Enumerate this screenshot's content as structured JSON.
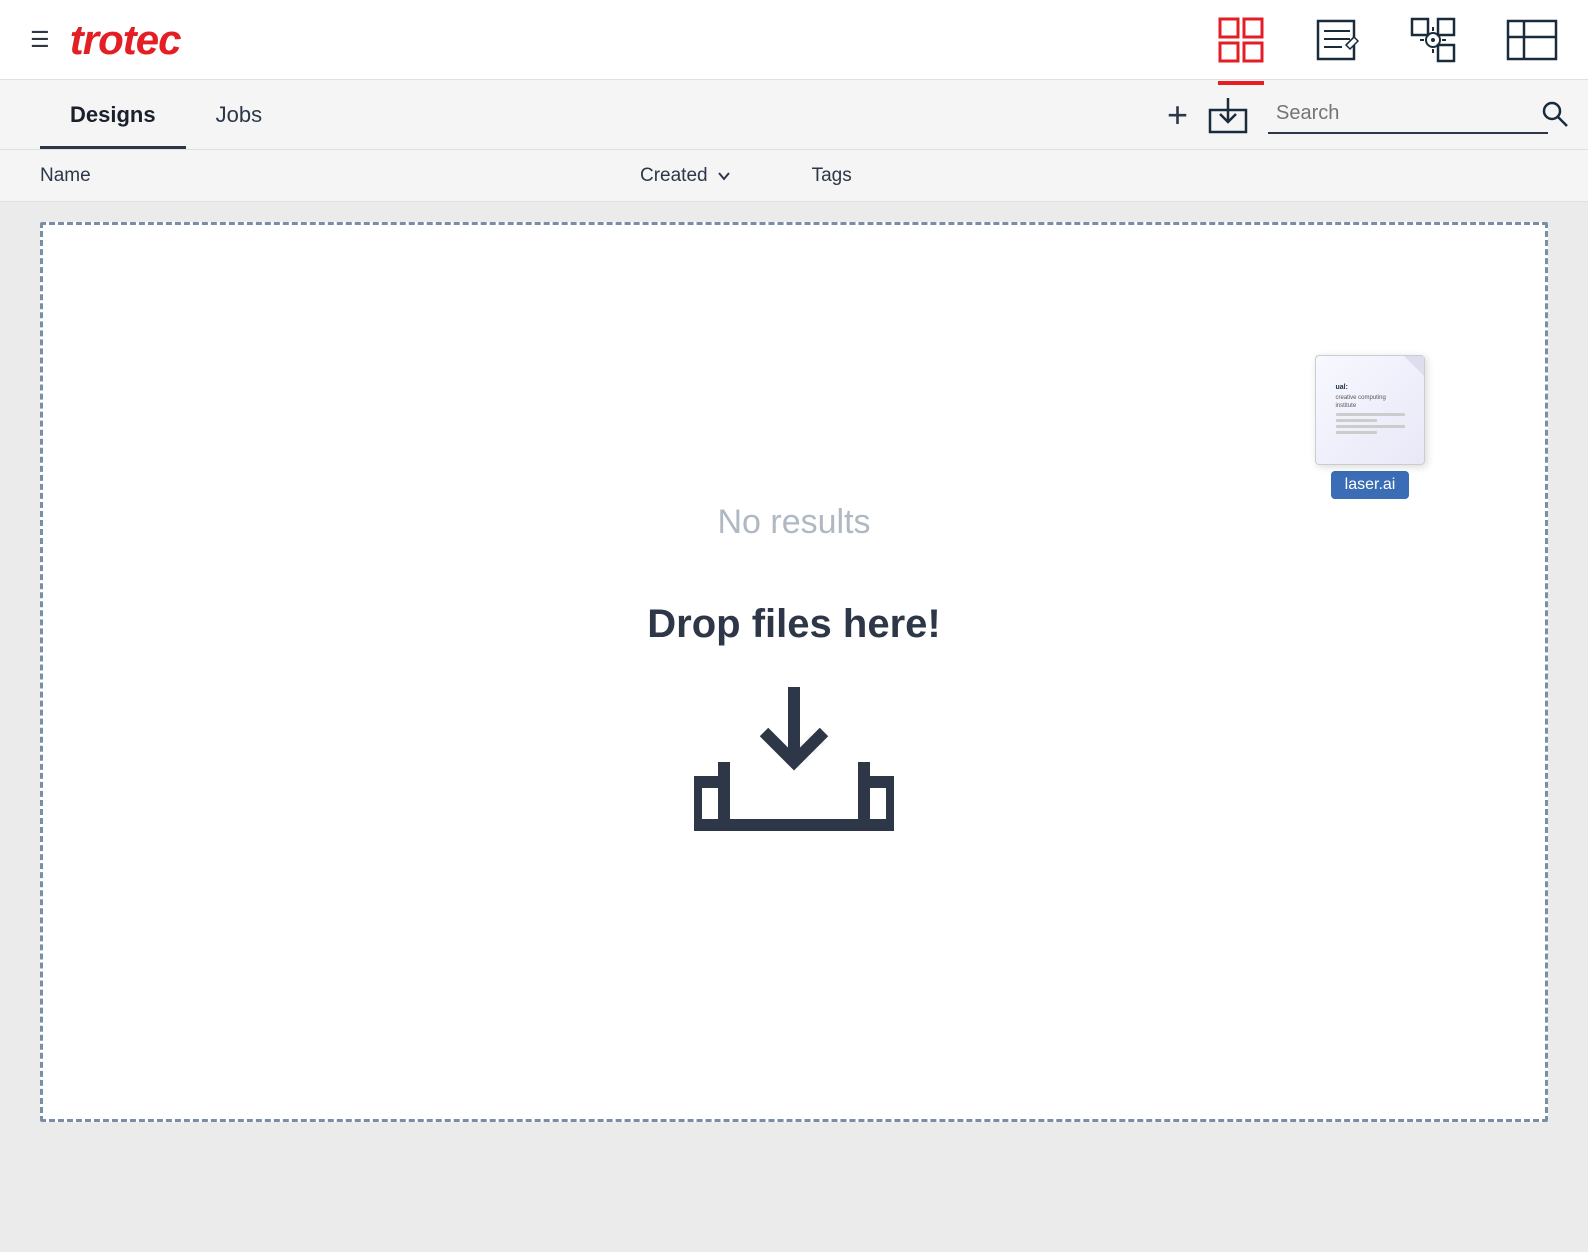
{
  "header": {
    "menu_label": "☰",
    "logo": "trotec",
    "icons": {
      "grid": "grid-icon",
      "edit": "edit-icon",
      "target": "target-icon",
      "panel": "panel-icon"
    }
  },
  "tabs": {
    "designs_label": "Designs",
    "jobs_label": "Jobs"
  },
  "toolbar": {
    "add_label": "+",
    "search_placeholder": "Search",
    "search_label": "Search"
  },
  "columns": {
    "name_label": "Name",
    "created_label": "Created",
    "tags_label": "Tags"
  },
  "content": {
    "no_results": "No results",
    "drop_text": "Drop files here!",
    "file_name": "laser.ai",
    "file_label1": "ual:",
    "file_label2": "creative computing",
    "file_label3": "institute"
  },
  "colors": {
    "accent_red": "#e31e24",
    "nav_dark": "#2d3748",
    "file_badge": "#3a6db5"
  }
}
